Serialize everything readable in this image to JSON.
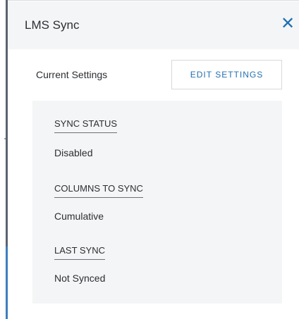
{
  "dialog": {
    "title": "LMS Sync",
    "close_icon": "close-icon"
  },
  "settings": {
    "current_label": "Current Settings",
    "edit_button_label": "EDIT SETTINGS"
  },
  "fields": [
    {
      "label": "SYNC STATUS",
      "value": "Disabled"
    },
    {
      "label": "COLUMNS TO SYNC",
      "value": "Cumulative"
    },
    {
      "label": "LAST SYNC",
      "value": "Not Synced"
    }
  ],
  "colors": {
    "accent": "#1f6fb2",
    "header_bg": "#f4f5f6",
    "box_bg": "#f4f5f6",
    "text": "#2b2f33"
  }
}
